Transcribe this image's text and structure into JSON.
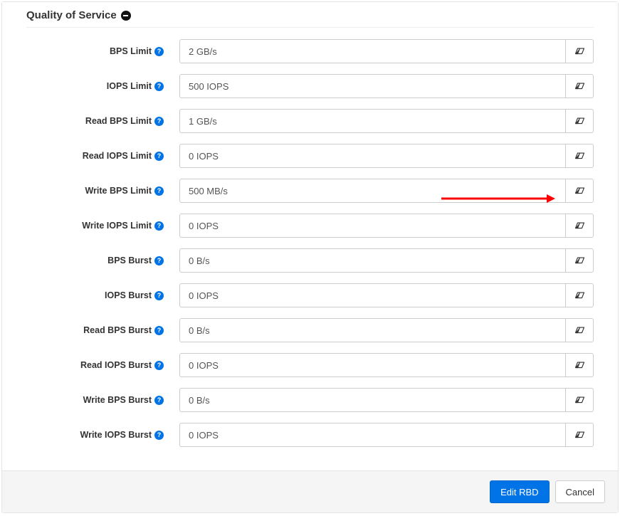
{
  "section": {
    "title": "Quality of Service"
  },
  "fields": [
    {
      "key": "bps_limit",
      "label": "BPS Limit",
      "value": "2 GB/s"
    },
    {
      "key": "iops_limit",
      "label": "IOPS Limit",
      "value": "500 IOPS"
    },
    {
      "key": "read_bps_limit",
      "label": "Read BPS Limit",
      "value": "1 GB/s"
    },
    {
      "key": "read_iops_limit",
      "label": "Read IOPS Limit",
      "value": "0 IOPS"
    },
    {
      "key": "write_bps_limit",
      "label": "Write BPS Limit",
      "value": "500 MB/s"
    },
    {
      "key": "write_iops_limit",
      "label": "Write IOPS Limit",
      "value": "0 IOPS"
    },
    {
      "key": "bps_burst",
      "label": "BPS Burst",
      "value": "0 B/s"
    },
    {
      "key": "iops_burst",
      "label": "IOPS Burst",
      "value": "0 IOPS"
    },
    {
      "key": "read_bps_burst",
      "label": "Read BPS Burst",
      "value": "0 B/s"
    },
    {
      "key": "read_iops_burst",
      "label": "Read IOPS Burst",
      "value": "0 IOPS"
    },
    {
      "key": "write_bps_burst",
      "label": "Write BPS Burst",
      "value": "0 B/s"
    },
    {
      "key": "write_iops_burst",
      "label": "Write IOPS Burst",
      "value": "0 IOPS"
    }
  ],
  "footer": {
    "submit_label": "Edit RBD",
    "cancel_label": "Cancel"
  },
  "colors": {
    "primary": "#0073e6",
    "border": "#cccccc",
    "annotation": "#ff0000"
  }
}
